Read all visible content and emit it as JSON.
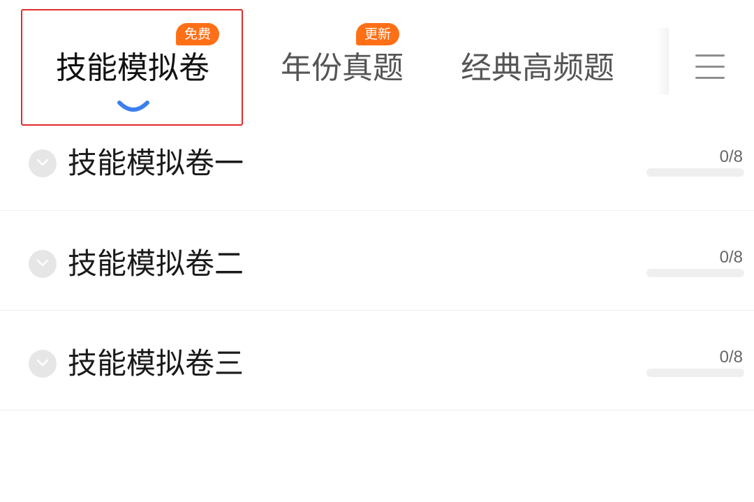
{
  "tabs": [
    {
      "label": "技能模拟卷",
      "badge": "免费",
      "active": true
    },
    {
      "label": "年份真题",
      "badge": "更新",
      "active": false
    },
    {
      "label": "经典高频题",
      "badge": "",
      "active": false
    }
  ],
  "menu": {
    "icon": "hamburger-menu-icon"
  },
  "colors": {
    "accent_indicator": "#3b7ff0",
    "badge": "#ff6f16",
    "highlight_box": "#e22b2b"
  },
  "papers": [
    {
      "title": "技能模拟卷一",
      "progress_text": "0/8",
      "progress": 0
    },
    {
      "title": "技能模拟卷二",
      "progress_text": "0/8",
      "progress": 0
    },
    {
      "title": "技能模拟卷三",
      "progress_text": "0/8",
      "progress": 0
    }
  ]
}
